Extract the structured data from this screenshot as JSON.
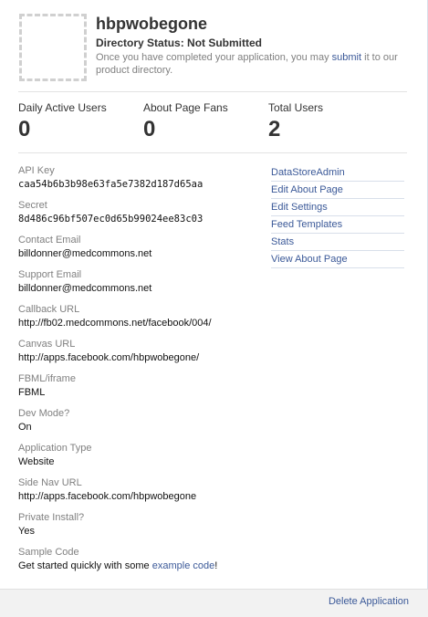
{
  "app": {
    "name": "hbpwobegone",
    "directory_status": "Directory Status: Not Submitted",
    "note_before": "Once you have completed your application, you may ",
    "note_link": "submit",
    "note_after": " it to our product directory."
  },
  "stats": [
    {
      "label": "Daily Active Users",
      "value": "0"
    },
    {
      "label": "About Page Fans",
      "value": "0"
    },
    {
      "label": "Total Users",
      "value": "2"
    }
  ],
  "fields": {
    "api_key": {
      "label": "API Key",
      "value": "caa54b6b3b98e63fa5e7382d187d65aa"
    },
    "secret": {
      "label": "Secret",
      "value": "8d486c96bf507ec0d65b99024ee83c03"
    },
    "contact_email": {
      "label": "Contact Email",
      "value": "billdonner@medcommons.net"
    },
    "support_email": {
      "label": "Support Email",
      "value": "billdonner@medcommons.net"
    },
    "callback_url": {
      "label": "Callback URL",
      "value": "http://fb02.medcommons.net/facebook/004/"
    },
    "canvas_url": {
      "label": "Canvas URL",
      "value": "http://apps.facebook.com/hbpwobegone/"
    },
    "fbml_iframe": {
      "label": "FBML/iframe",
      "value": "FBML"
    },
    "dev_mode": {
      "label": "Dev Mode?",
      "value": "On"
    },
    "app_type": {
      "label": "Application Type",
      "value": "Website"
    },
    "side_nav_url": {
      "label": "Side Nav URL",
      "value": "http://apps.facebook.com/hbpwobegone"
    },
    "private_install": {
      "label": "Private Install?",
      "value": "Yes"
    },
    "sample_code": {
      "label": "Sample Code",
      "before": "Get started quickly with some ",
      "link": "example code",
      "after": "!"
    }
  },
  "side_links": [
    "DataStoreAdmin",
    "Edit About Page",
    "Edit Settings",
    "Feed Templates",
    "Stats",
    "View About Page"
  ],
  "footer": {
    "delete_label": "Delete Application"
  },
  "colors": {
    "link": "#3b5998",
    "label": "#808080",
    "divider": "#e3e3e3",
    "footer_bg": "#f2f2f2"
  }
}
